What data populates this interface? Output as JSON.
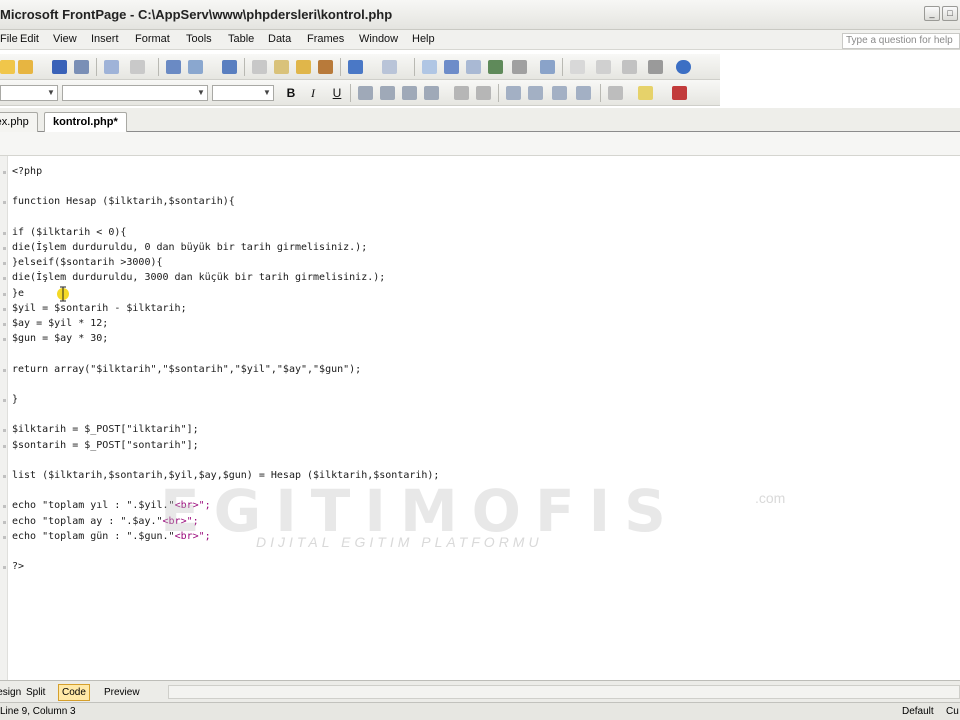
{
  "window": {
    "title": "Microsoft FrontPage - C:\\AppServ\\www\\phpdersleri\\kontrol.php",
    "minimize_glyph": "_",
    "maximize_glyph": "□"
  },
  "menu": {
    "items": [
      "File",
      "Edit",
      "View",
      "Insert",
      "Format",
      "Tools",
      "Table",
      "Data",
      "Frames",
      "Window",
      "Help"
    ],
    "help_placeholder": "Type a question for help"
  },
  "formatting": {
    "bold": "B",
    "italic": "I",
    "underline": "U"
  },
  "tabs": [
    {
      "label": "index.php",
      "active": false
    },
    {
      "label": "kontrol.php*",
      "active": true
    }
  ],
  "code": {
    "lines": [
      "<?php",
      "",
      "function Hesap ($ilktarih,$sontarih){",
      "",
      "if ($ilktarih < 0){",
      "die(İşlem durduruldu, 0 dan büyük bir tarih girmelisiniz.);",
      "}elseif($sontarih >3000){",
      "die(İşlem durduruldu, 3000 dan küçük bir tarih girmelisiniz.);",
      "}e",
      "$yil = $sontarih - $ilktarih;",
      "$ay = $yil * 12;",
      "$gun = $ay * 30;",
      "",
      "return array(\"$ilktarih\",\"$sontarih\",\"$yil\",\"$ay\",\"$gun\");",
      "",
      "}",
      "",
      "$ilktarih = $_POST[\"ilktarih\"];",
      "$sontarih = $_POST[\"sontarih\"];",
      "",
      "list ($ilktarih,$sontarih,$yil,$ay,$gun) = Hesap ($ilktarih,$sontarih);",
      "",
      "echo \"toplam yıl : \".$yil.\"",
      "echo \"toplam ay : \".$ay.\"",
      "echo \"toplam gün : \".$gun.\"",
      "",
      "?>"
    ],
    "br_suffix": "<br>\";"
  },
  "watermark": {
    "brand": "EGITIMOFIS",
    "tld": ".com",
    "tagline": "DIJITAL EGITIM PLATFORMU"
  },
  "views": [
    {
      "label": "Design",
      "active": false
    },
    {
      "label": "Split",
      "active": false
    },
    {
      "label": "Code",
      "active": true
    },
    {
      "label": "Preview",
      "active": false
    }
  ],
  "status": {
    "position": "Line 9, Column 3",
    "mode": "Default",
    "extra": "Cu"
  },
  "colors": {
    "active_view": "#ffe9a8",
    "html_tag": "#9b0a7c",
    "cursor": "#f2d200"
  }
}
